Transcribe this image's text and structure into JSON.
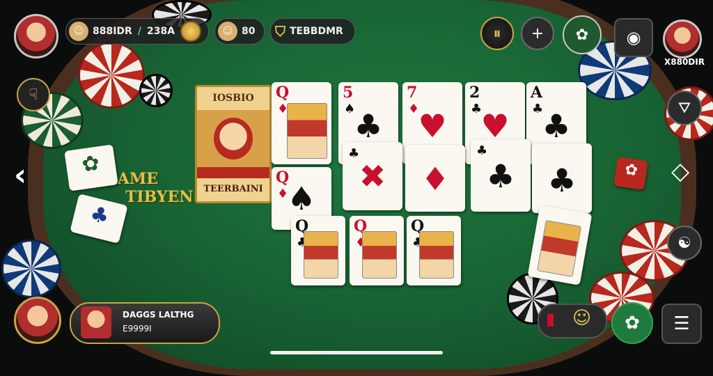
{
  "player": {
    "balance": "888IDR",
    "bet": "238A",
    "level": "80",
    "name": "TEBBDMR"
  },
  "opponent": {
    "name": "X880DIR"
  },
  "feature_card": {
    "label": "TEERBAINI",
    "header": "IOSBIO"
  },
  "hud": {
    "title": "DAGGS LALTHG",
    "amount": "E9999I"
  },
  "logo": {
    "line1": "GAME",
    "line2": "TIBYEN"
  },
  "controls": {
    "menu_icon": "menu-icon",
    "camera_icon": "camera-icon",
    "settings_icon": "gear-icon",
    "add_icon": "plus-icon"
  },
  "cards": {
    "top_row": [
      {
        "rank": "Q",
        "suit": "♦",
        "color": "red",
        "face": true
      },
      {
        "rank": "5",
        "suit": "♠",
        "color": "red",
        "face": false,
        "center": "♣"
      },
      {
        "rank": "7",
        "suit": "♦",
        "color": "red",
        "face": false,
        "center": "♥"
      },
      {
        "rank": "2",
        "suit": "♣",
        "color": "black",
        "face": false,
        "center": "♥"
      },
      {
        "rank": "A",
        "suit": "♣",
        "color": "black",
        "face": false,
        "center": "♣"
      }
    ],
    "middle_row": [
      {
        "rank": "Q",
        "suit": "♦",
        "color": "red",
        "face": false,
        "center": "♠"
      },
      {
        "rank": "",
        "suit": "♣",
        "color": "black",
        "face": false,
        "center": "✖"
      },
      {
        "rank": "",
        "suit": "",
        "color": "red",
        "face": false,
        "center": "♦"
      },
      {
        "rank": "",
        "suit": "♣",
        "color": "black",
        "face": false,
        "center": "♣"
      },
      {
        "rank": "",
        "suit": "",
        "color": "black",
        "face": false,
        "center": "♣"
      }
    ],
    "bottom_row": [
      {
        "rank": "Q",
        "suit": "♣",
        "color": "black",
        "face": true
      },
      {
        "rank": "Q",
        "suit": "♦",
        "color": "red",
        "face": true
      },
      {
        "rank": "Q",
        "suit": "♣",
        "color": "black",
        "face": true
      }
    ]
  }
}
